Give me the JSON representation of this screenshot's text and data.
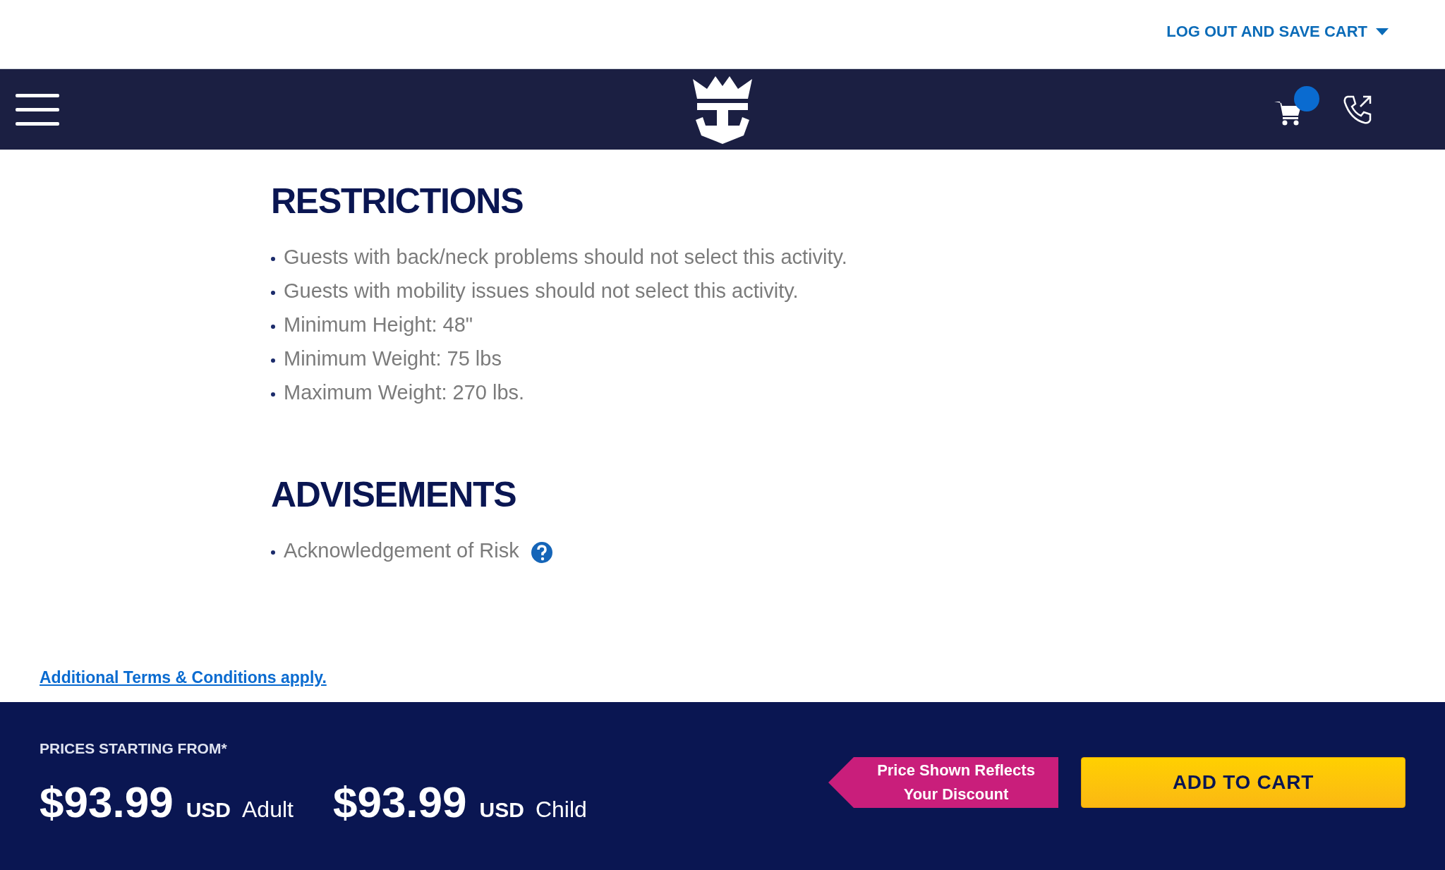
{
  "top_bar": {
    "account_link": "LOG OUT AND SAVE CART"
  },
  "cart": {
    "has_items": true
  },
  "sections": [
    {
      "title": "RESTRICTIONS",
      "items": [
        {
          "text": "Guests with back/neck problems should not select this activity.",
          "help": false
        },
        {
          "text": "Guests with mobility issues should not select this activity.",
          "help": false
        },
        {
          "text": "Minimum Height: 48\"",
          "help": false
        },
        {
          "text": "Minimum Weight: 75 lbs",
          "help": false
        },
        {
          "text": "Maximum Weight: 270 lbs.",
          "help": false
        }
      ]
    },
    {
      "title": "ADVISEMENTS",
      "items": [
        {
          "text": "Acknowledgement of Risk",
          "help": true
        }
      ]
    }
  ],
  "terms_link": "Additional Terms & Conditions apply.",
  "footer": {
    "label": "PRICES STARTING FROM*",
    "prices": [
      {
        "amount": "$93.99",
        "currency": "USD",
        "type": "Adult"
      },
      {
        "amount": "$93.99",
        "currency": "USD",
        "type": "Child"
      }
    ],
    "discount_ribbon": [
      "Price Shown Reflects",
      "Your Discount"
    ],
    "add_button": "ADD TO CART"
  }
}
